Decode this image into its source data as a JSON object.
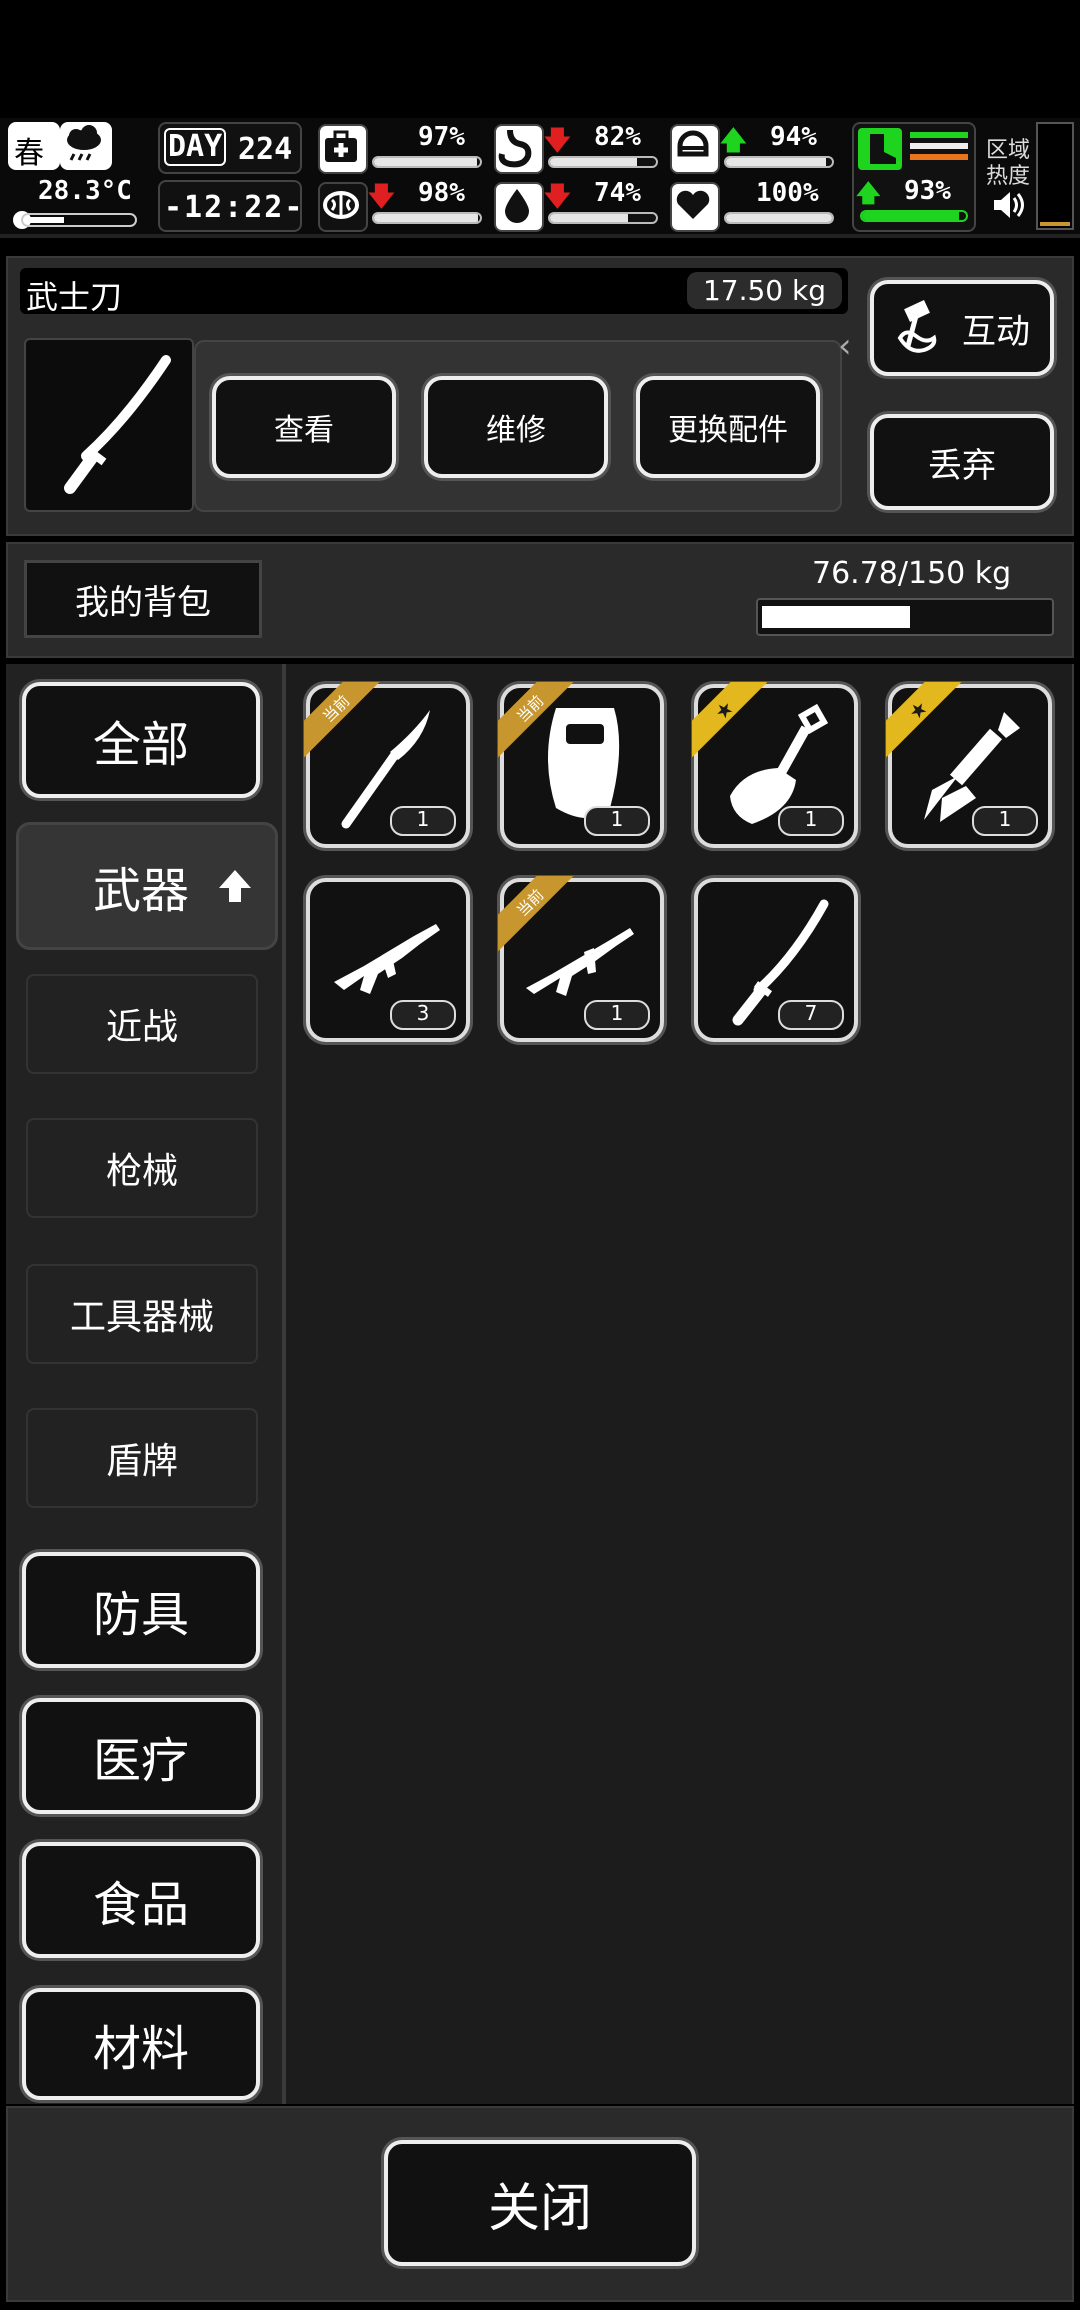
{
  "hud": {
    "season": "春",
    "temperature": "28.3°C",
    "day_label": "DAY",
    "day_number": "224",
    "clock": "-12:22-",
    "stats": [
      {
        "id": "health",
        "value": "97%",
        "fill": 0.97,
        "trend": "none"
      },
      {
        "id": "hunger",
        "value": "82%",
        "fill": 0.82,
        "trend": "down"
      },
      {
        "id": "armor",
        "value": "94%",
        "fill": 0.94,
        "trend": "up"
      },
      {
        "id": "mental",
        "value": "98%",
        "fill": 0.98,
        "trend": "down"
      },
      {
        "id": "thirst",
        "value": "74%",
        "fill": 0.74,
        "trend": "down"
      },
      {
        "id": "heart",
        "value": "100%",
        "fill": 1.0,
        "trend": "none"
      },
      {
        "id": "stamina",
        "value": "93%",
        "fill": 0.93,
        "trend": "up"
      }
    ],
    "zone_heat_label_1": "区域",
    "zone_heat_label_2": "热度"
  },
  "selected_item": {
    "name": "武士刀",
    "weight": "17.50 kg",
    "actions": {
      "view": "查看",
      "repair": "维修",
      "swap_parts": "更换配件"
    }
  },
  "side_actions": {
    "interact": "互动",
    "discard": "丢弃"
  },
  "backpack": {
    "label": "我的背包",
    "capacity": "76.78/150 kg",
    "fill_fraction": 0.51
  },
  "categories": {
    "all": "全部",
    "weapons": "武器",
    "melee": "近战",
    "firearms": "枪械",
    "tools": "工具器械",
    "shields": "盾牌",
    "armor": "防具",
    "medical": "医疗",
    "food": "食品",
    "materials": "材料"
  },
  "items": [
    {
      "icon": "scalpel-icon",
      "count": "1",
      "ribbon": "当前"
    },
    {
      "icon": "riot-shield-icon",
      "count": "1",
      "ribbon": "当前"
    },
    {
      "icon": "shovel-icon",
      "count": "1",
      "ribbon": "★"
    },
    {
      "icon": "multitool-knife-icon",
      "count": "1",
      "ribbon": "★"
    },
    {
      "icon": "ak-rifle-icon",
      "count": "3",
      "ribbon": ""
    },
    {
      "icon": "assault-rifle-icon",
      "count": "1",
      "ribbon": "当前"
    },
    {
      "icon": "katana-icon",
      "count": "7",
      "ribbon": ""
    }
  ],
  "close_label": "关闭",
  "colors": {
    "ribbon_current": "#c8962e",
    "ribbon_favorite": "#e3b81e",
    "stamina_bar": "#1fd41f"
  }
}
